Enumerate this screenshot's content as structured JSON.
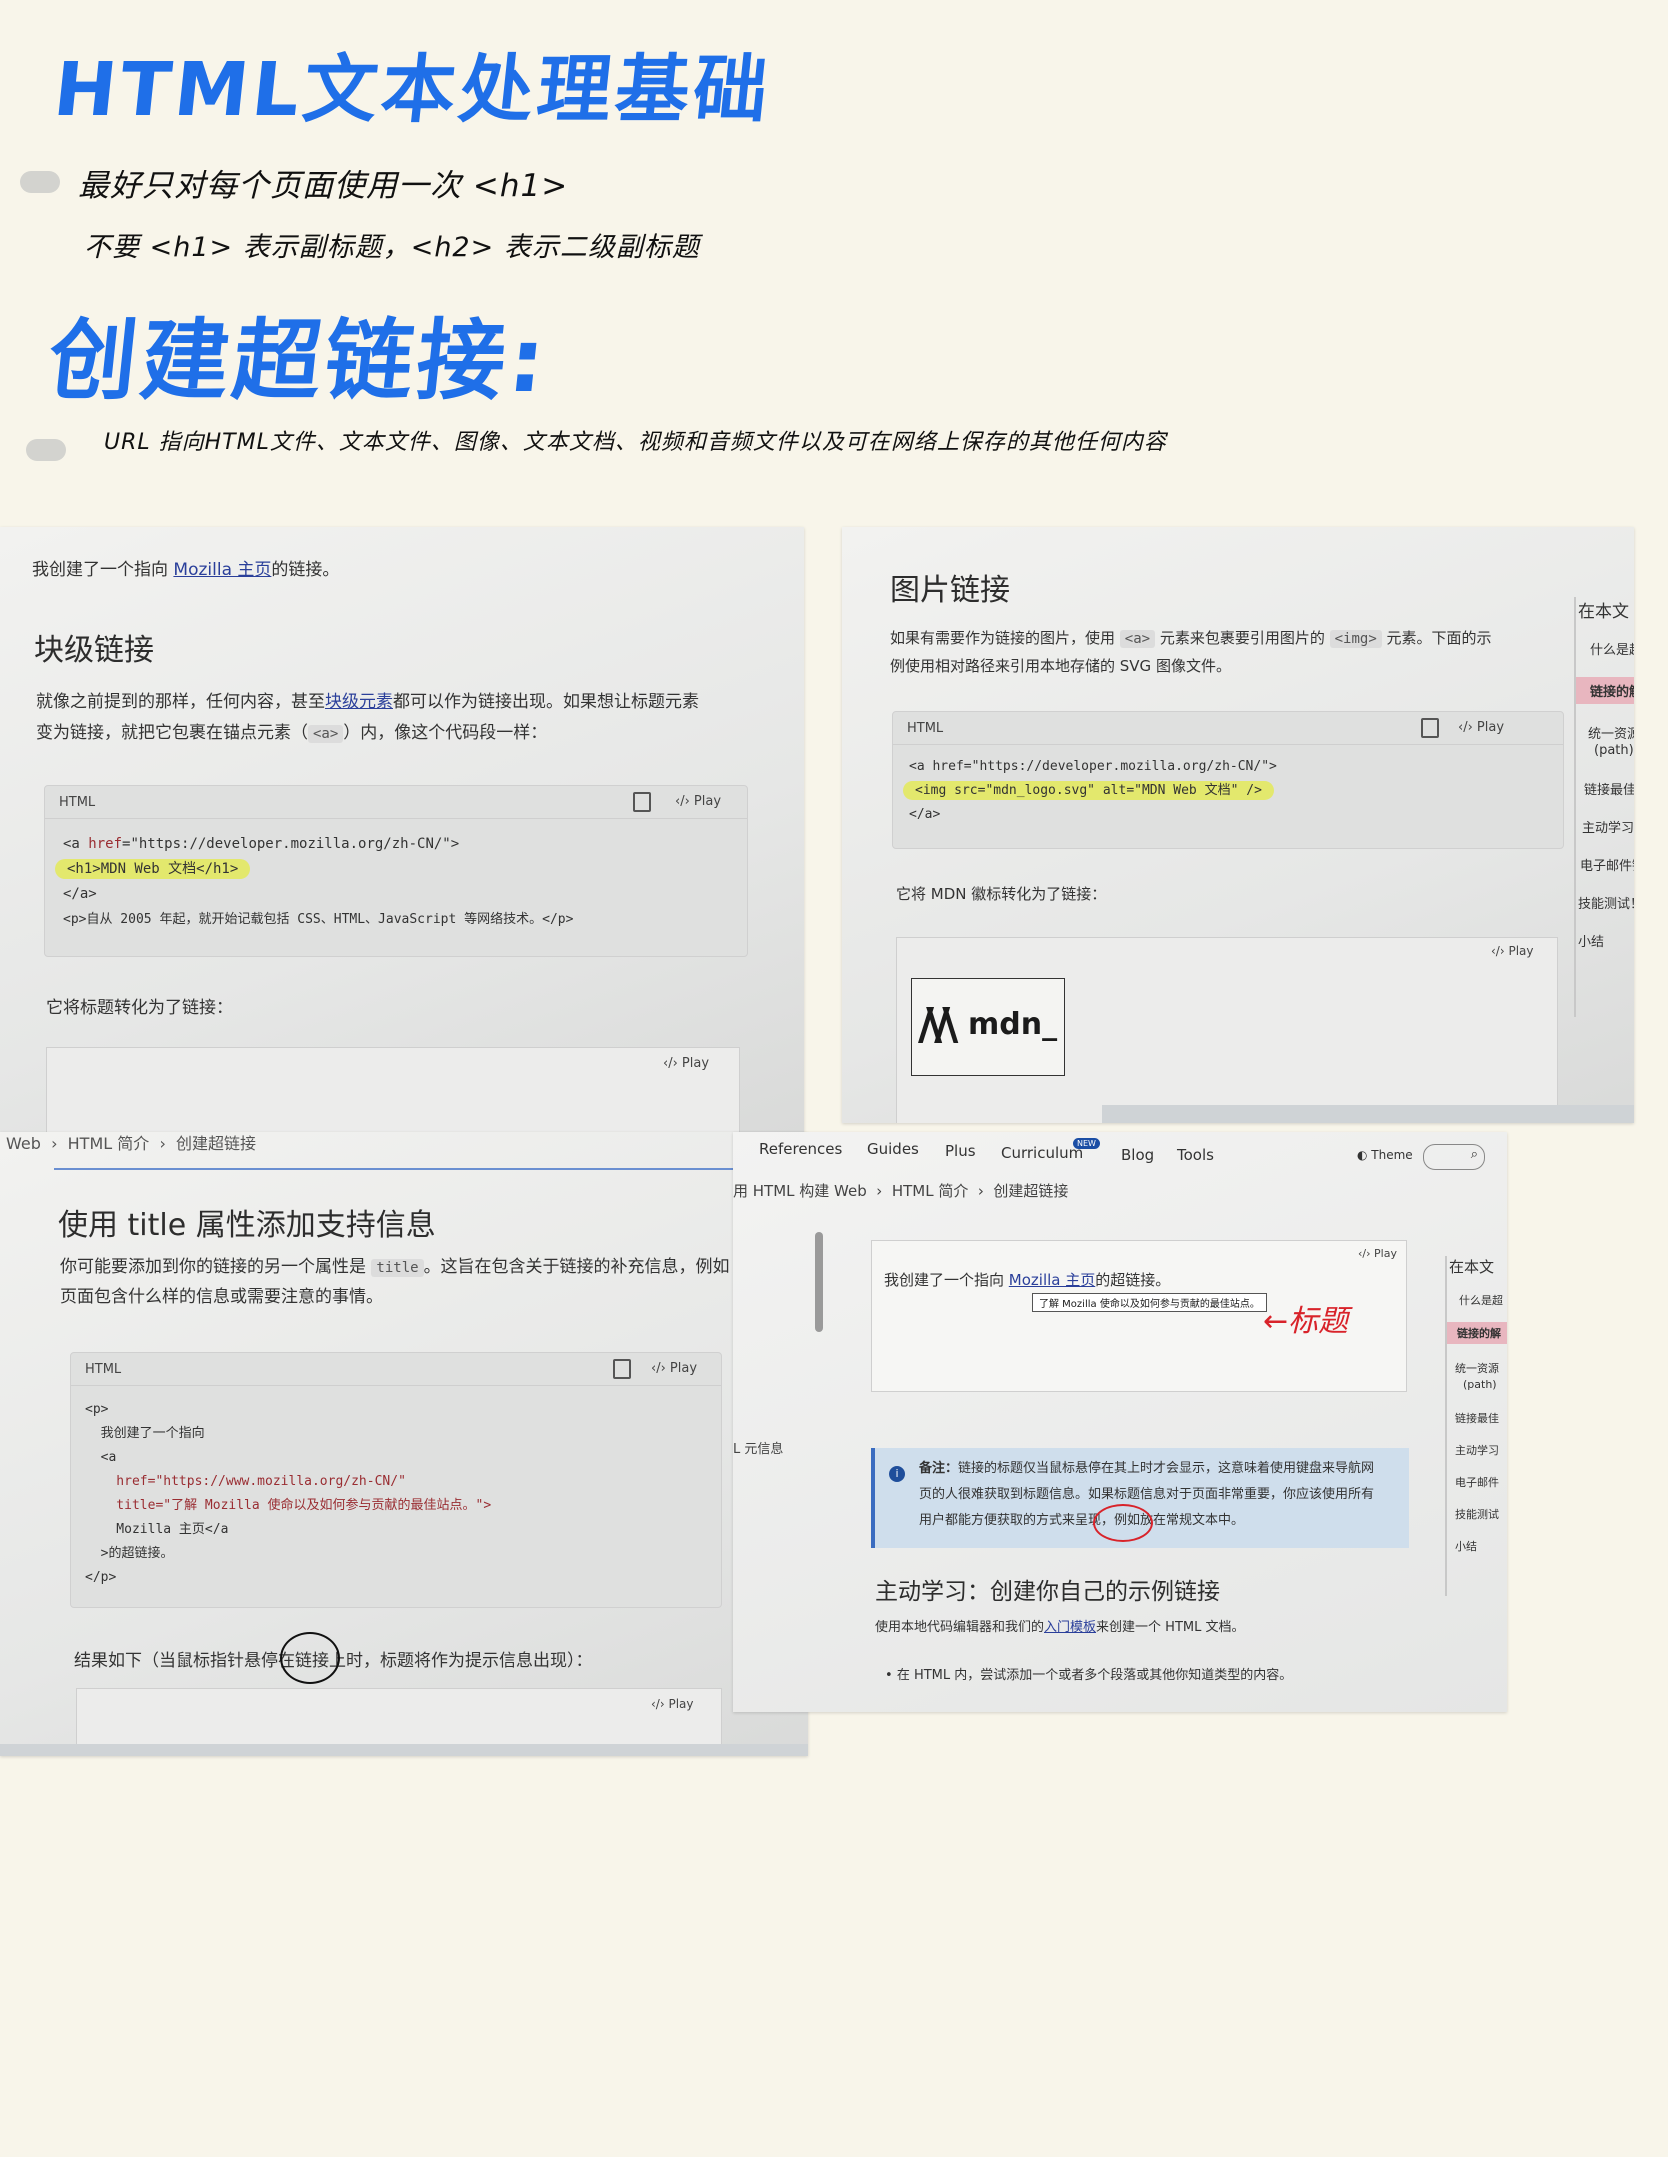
{
  "notes": {
    "title": "HTML文本处理基础",
    "bullet1_line1": "最好只对每个页面使用一次 <h1>",
    "bullet1_line2": "不要 <h1> 表示副标题，<h2> 表示二级副标题",
    "section_title": "创建超链接:",
    "bullet2": "URL 指向HTML文件、文本文件、图像、文本文档、视频和音频文件以及可在网络上保存的其他任何内容"
  },
  "shot1": {
    "intro_before": "我创建了一个指向 ",
    "intro_link": "Mozilla 主页",
    "intro_after": "的链接。",
    "heading": "块级链接",
    "para1_a": "就像之前提到的那样，任何内容，甚至",
    "para1_link": "块级元素",
    "para1_b": "都可以作为链接出现。如果想让标题元素",
    "para2_a": "变为链接，就把它包裹在锚点元素（",
    "para2_code": "<a>",
    "para2_b": "）内，像这个代码段一样：",
    "code_lang": "HTML",
    "play": "Play",
    "code_line1_a": "<a ",
    "code_line1_attr": "href",
    "code_line1_b": "=\"https://developer.mozilla.org/zh-CN/\">",
    "code_line2": "<h1>MDN Web 文档</h1>",
    "code_line3": "</a>",
    "code_line4": "<p>自从 2005 年起，就开始记载包括 CSS、HTML、JavaScript 等网络技术。</p>",
    "result_text": "它将标题转化为了链接：",
    "result_play": "Play"
  },
  "shot2": {
    "heading": "图片链接",
    "para1_a": "如果有需要作为链接的图片，使用 ",
    "para1_code1": "<a>",
    "para1_b": " 元素来包裹要引用图片的 ",
    "para1_code2": "<img>",
    "para1_c": " 元素。下面的示",
    "para2": "例使用相对路径来引用本地存储的 SVG 图像文件。",
    "code_lang": "HTML",
    "play": "Play",
    "code_line1": "<a href=\"https://developer.mozilla.org/zh-CN/\">",
    "code_line2": "<img src=\"mdn_logo.svg\" alt=\"MDN Web 文档\" />",
    "code_line3": "</a>",
    "result_text": "它将 MDN 徽标转化为了链接：",
    "result_play": "Play",
    "logo_text": "mdn_",
    "toc": [
      "在本文",
      "什么是超",
      "链接的解",
      "统一资源",
      "(path)",
      "链接最佳",
      "主动学习：",
      "电子邮件链",
      "技能测试！",
      "小结"
    ]
  },
  "shot3": {
    "breadcrumb": [
      "Web",
      "HTML 简介",
      "创建超链接"
    ],
    "heading": "使用 title 属性添加支持信息",
    "para1_a": "你可能要添加到你的链接的另一个属性是 ",
    "para1_code": "title",
    "para1_b": "。这旨在包含关于链接的补充信息，例如",
    "para2": "页面包含什么样的信息或需要注意的事情。",
    "code_lang": "HTML",
    "play": "Play",
    "code_lines": [
      "<p>",
      "  我创建了一个指向",
      "  <a",
      "    href=\"https://www.mozilla.org/zh-CN/\"",
      "    title=\"了解 Mozilla 使命以及如何参与贡献的最佳站点。\">",
      "    Mozilla 主页</a",
      "  >的超链接。",
      "</p>"
    ],
    "result_text": "结果如下（当鼠标指针悬停在链接上时，标题将作为提示信息出现）：",
    "result_play": "Play"
  },
  "shot4": {
    "nav": [
      "References",
      "Guides",
      "Plus",
      "Curriculum",
      "Blog",
      "Tools"
    ],
    "nav_badge": "NEW",
    "theme": "Theme",
    "breadcrumb": [
      "用 HTML 构建 Web",
      "HTML 简介",
      "创建超链接"
    ],
    "play": "Play",
    "demo_before": "我创建了一个指向 ",
    "demo_link": "Mozilla 主页",
    "demo_after": "的超链接。",
    "tooltip": "了解 Mozilla 使命以及如何参与贡献的最佳站点。",
    "annotation": "←标题",
    "side_label": "L 元信息",
    "note_label": "备注：",
    "note_line1": "链接的标题仅当鼠标悬停在其上时才会显示，这意味着使用键盘来导航网",
    "note_line2": "页的人很难获取到标题信息。如果标题信息对于页面非常重要，你应该使用所有",
    "note_line3": "用户都能方便获取的方式来呈现，例如放在常规文本中。",
    "heading": "主动学习：创建你自己的示例链接",
    "para_a": "使用本地代码编辑器和我们的",
    "para_link": "入门模板",
    "para_b": "来创建一个 HTML 文档。",
    "list_item": "在 HTML 内，尝试添加一个或者多个段落或其他你知道类型的内容。",
    "toc": [
      "在本文",
      "什么是超",
      "链接的解",
      "统一资源",
      "(path)",
      "链接最佳",
      "主动学习",
      "电子邮件",
      "技能测试",
      "小结"
    ]
  },
  "colors": {
    "note_bg": "#f8f5ea",
    "hand_blue": "#1f6fe8",
    "link": "#2a3f9a",
    "highlight": "#e3e86d",
    "annotation_red": "#d8232a"
  }
}
